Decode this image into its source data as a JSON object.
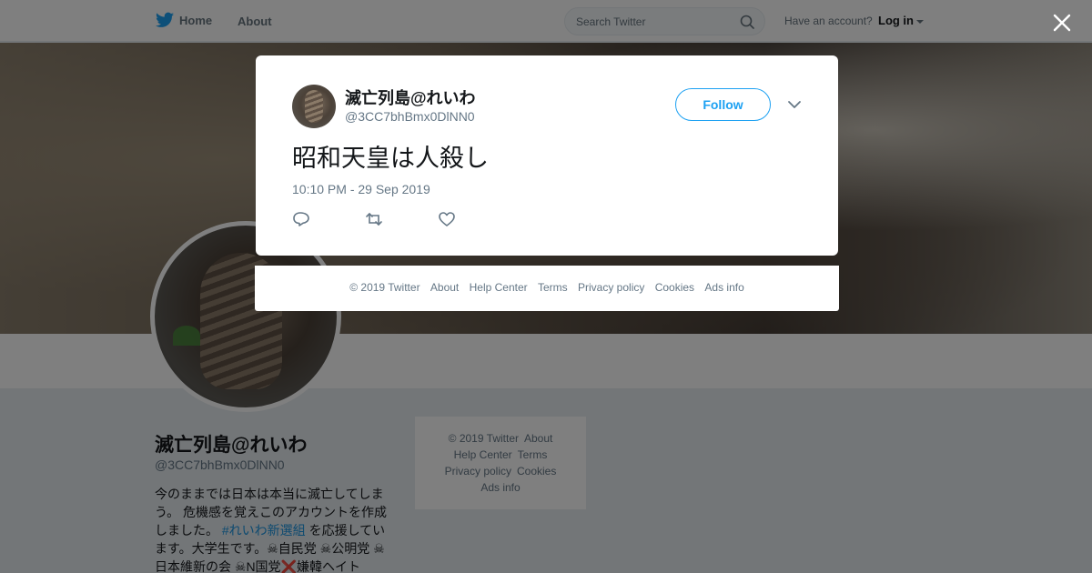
{
  "nav": {
    "home_label": "Home",
    "about_label": "About",
    "search_placeholder": "Search Twitter",
    "account_prompt": "Have an account?",
    "login_label": "Log in"
  },
  "profile": {
    "name": "滅亡列島@れいわ",
    "handle": "@3CC7bhBmx0DlNN0",
    "bio_part1": "今のままでは日本は本当に滅亡してしまう。 危機感を覚えこのアカウントを作成しました。 ",
    "bio_hashtag": "#れいわ新選組",
    "bio_part2": " を応援しています。大学生です。☠自民党 ☠公明党 ☠日本維新の会 ☠N国党❌嫌韓ヘイト"
  },
  "side_footer": {
    "copyright": "© 2019 Twitter",
    "about": "About",
    "help": "Help Center",
    "terms": "Terms",
    "privacy": "Privacy policy",
    "cookies": "Cookies",
    "ads": "Ads info"
  },
  "tweet": {
    "author_name": "滅亡列島@れいわ",
    "author_handle": "@3CC7bhBmx0DlNN0",
    "follow_label": "Follow",
    "text": "昭和天皇は人殺し",
    "timestamp": "10:10 PM - 29 Sep 2019",
    "icons": {
      "reply": "reply-icon",
      "retweet": "retweet-icon",
      "like": "heart-icon",
      "more": "chevron-down-icon",
      "close": "close-icon"
    }
  },
  "overlay_footer": {
    "copyright": "© 2019 Twitter",
    "about": "About",
    "help": "Help Center",
    "terms": "Terms",
    "privacy": "Privacy policy",
    "cookies": "Cookies",
    "ads": "Ads info"
  },
  "colors": {
    "brand_blue": "#1da1f2",
    "text_primary": "#14171a",
    "text_secondary": "#657786",
    "backdrop": "rgba(0,0,0,0.5)"
  }
}
